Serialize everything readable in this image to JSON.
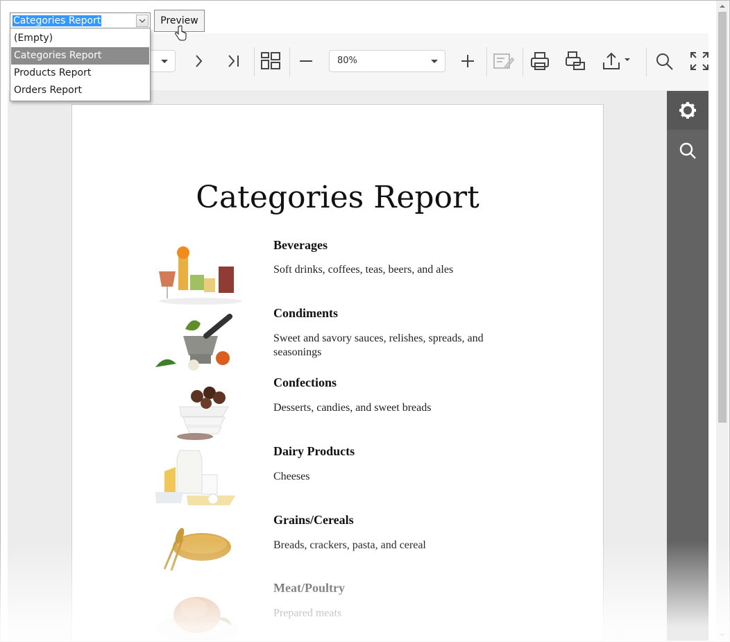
{
  "report_select": {
    "value": "Categories Report"
  },
  "preview_button": {
    "label": "Preview"
  },
  "dropdown": {
    "items": [
      "(Empty)",
      "Categories Report",
      "Products Report",
      "Orders Report"
    ]
  },
  "toolbar": {
    "zoom_value": "80%"
  },
  "report": {
    "title": "Categories Report",
    "categories": [
      {
        "name": "Beverages",
        "description": "Soft drinks, coffees, teas, beers, and ales"
      },
      {
        "name": "Condiments",
        "description": "Sweet and savory sauces, relishes, spreads, and seasonings"
      },
      {
        "name": "Confections",
        "description": "Desserts, candies, and sweet breads"
      },
      {
        "name": "Dairy Products",
        "description": "Cheeses"
      },
      {
        "name": "Grains/Cereals",
        "description": "Breads, crackers, pasta, and cereal"
      },
      {
        "name": "Meat/Poultry",
        "description": "Prepared meats"
      }
    ]
  },
  "colors": {
    "selection": "#3399ff",
    "sidebar": "#636363",
    "dropdown_selected": "#8c8c8c"
  }
}
